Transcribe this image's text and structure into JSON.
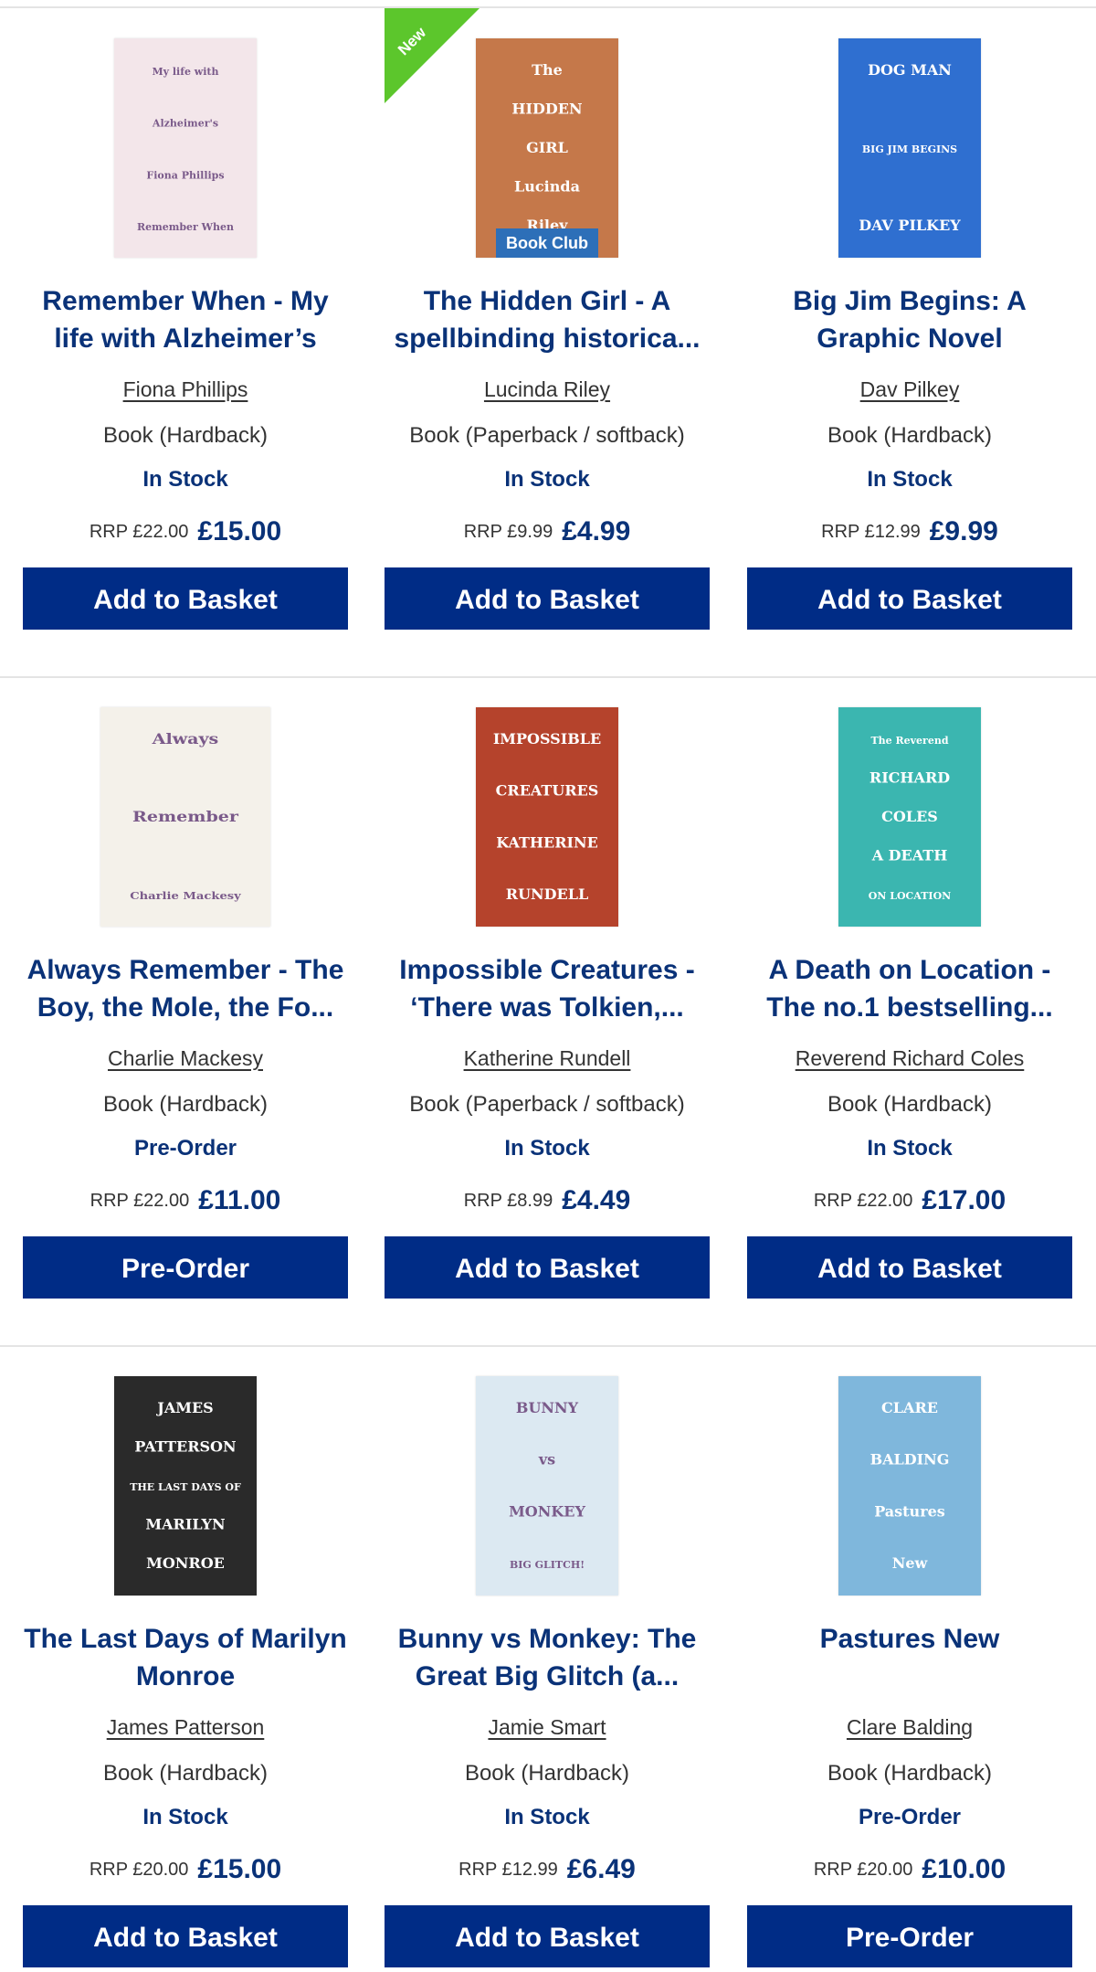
{
  "products": [
    {
      "title": "Remember When - My life with Alzheimer’s",
      "author": "Fiona Phillips",
      "format": "Book (Hardback)",
      "stock": "In Stock",
      "rrp": "RRP £22.00",
      "price": "£15.00",
      "button": "Add to Basket",
      "cover": {
        "color": "#f3e6ea",
        "lines": [
          "My life with",
          "Alzheimer's",
          "Fiona Phillips",
          "Remember When"
        ]
      }
    },
    {
      "title": "The Hidden Girl - A spellbinding historica...",
      "author": "Lucinda Riley",
      "format": "Book (Paperback / softback)",
      "stock": "In Stock",
      "rrp": "RRP £9.99",
      "price": "£4.99",
      "button": "Add to Basket",
      "ribbon": "New",
      "badge": "Book Club",
      "cover": {
        "color": "#c5784a",
        "lines": [
          "The",
          "HIDDEN",
          "GIRL",
          "Lucinda",
          "Riley"
        ]
      }
    },
    {
      "title": "Big Jim Begins: A Graphic Novel",
      "author": "Dav Pilkey",
      "format": "Book (Hardback)",
      "stock": "In Stock",
      "rrp": "RRP £12.99",
      "price": "£9.99",
      "button": "Add to Basket",
      "cover": {
        "color": "#2f6fd0",
        "lines": [
          "DOG MAN",
          "BIG JIM BEGINS",
          "DAV PILKEY"
        ]
      }
    },
    {
      "title": "Always Remember - The Boy, the Mole, the Fo...",
      "author": "Charlie Mackesy",
      "format": "Book (Hardback)",
      "stock": "Pre-Order",
      "rrp": "RRP £22.00",
      "price": "£11.00",
      "button": "Pre-Order",
      "cover": {
        "color": "#f4f1ea",
        "lines": [
          "Always",
          "Remember",
          "Charlie Mackesy"
        ]
      }
    },
    {
      "title": "Impossible Creatures - ‘There was Tolkien,...",
      "author": "Katherine Rundell",
      "format": "Book (Paperback / softback)",
      "stock": "In Stock",
      "rrp": "RRP £8.99",
      "price": "£4.49",
      "button": "Add to Basket",
      "cover": {
        "color": "#b5432c",
        "lines": [
          "IMPOSSIBLE",
          "CREATURES",
          "KATHERINE",
          "RUNDELL"
        ]
      }
    },
    {
      "title": "A Death on Location - The no.1 bestselling...",
      "author": "Reverend Richard Coles",
      "format": "Book (Hardback)",
      "stock": "In Stock",
      "rrp": "RRP £22.00",
      "price": "£17.00",
      "button": "Add to Basket",
      "cover": {
        "color": "#3bb6b0",
        "lines": [
          "The Reverend",
          "RICHARD",
          "COLES",
          "A DEATH",
          "ON LOCATION"
        ]
      }
    },
    {
      "title": "The Last Days of Marilyn Monroe",
      "author": "James Patterson",
      "format": "Book (Hardback)",
      "stock": "In Stock",
      "rrp": "RRP £20.00",
      "price": "£15.00",
      "button": "Add to Basket",
      "cover": {
        "color": "#2a2a2a",
        "lines": [
          "JAMES",
          "PATTERSON",
          "THE LAST DAYS OF",
          "MARILYN",
          "MONROE"
        ]
      }
    },
    {
      "title": "Bunny vs Monkey: The Great Big Glitch (a...",
      "author": "Jamie Smart",
      "format": "Book (Hardback)",
      "stock": "In Stock",
      "rrp": "RRP £12.99",
      "price": "£6.49",
      "button": "Add to Basket",
      "cover": {
        "color": "#dce9f2",
        "lines": [
          "BUNNY",
          "vs",
          "MONKEY",
          "BIG GLITCH!"
        ]
      }
    },
    {
      "title": "Pastures New",
      "author": "Clare Balding",
      "format": "Book (Hardback)",
      "stock": "Pre-Order",
      "rrp": "RRP £20.00",
      "price": "£10.00",
      "button": "Pre-Order",
      "cover": {
        "color": "#7fb7dc",
        "lines": [
          "CLARE",
          "BALDING",
          "Pastures",
          "New"
        ]
      }
    }
  ]
}
